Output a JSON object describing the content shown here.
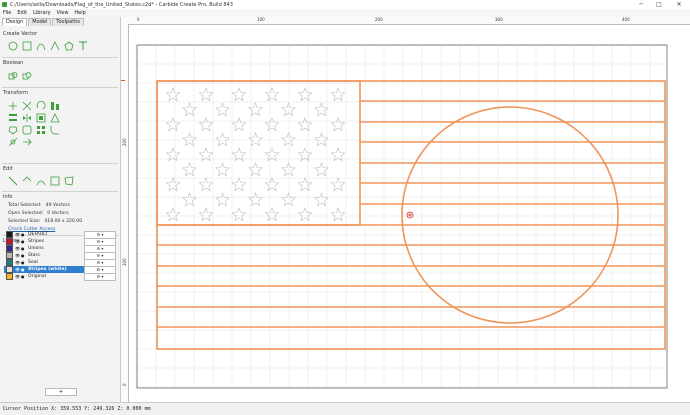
{
  "window": {
    "title": "C:/Users/sella/Downloads/Flag_of_the_United_States.c2d* - Carbide Create Pro, Build 843",
    "minimize": "─",
    "maximize": "□",
    "close": "✕"
  },
  "menu": [
    "File",
    "Edit",
    "Library",
    "View",
    "Help"
  ],
  "tabs": [
    "Design",
    "Model",
    "Toolpaths"
  ],
  "sections": {
    "create_vector": "Create Vector",
    "boolean": "Boolean",
    "transform": "Transform",
    "edit": "Edit",
    "info": "Info",
    "layers": "Layers"
  },
  "info": {
    "total_selected_label": "Total Selected:",
    "total_selected": "49 Vectors",
    "open_selected_label": "Open Selected:",
    "open_selected": "0 Vectors",
    "selected_size_label": "Selected Size:",
    "selected_size": "418.00 x 220.00",
    "check_cutter": "Check Cutter Access"
  },
  "layers": [
    {
      "name": "DEFAULT",
      "color": "#1a1a1a"
    },
    {
      "name": "Stripes",
      "color": "#c8102e"
    },
    {
      "name": "Unions",
      "color": "#2b2b8f"
    },
    {
      "name": "Stars",
      "color": "#b9b9b9"
    },
    {
      "name": "Seal",
      "color": "#1f7a7a"
    },
    {
      "name": "Stripes (white)",
      "color": "#e8e0d0"
    },
    {
      "name": "Original",
      "color": "#f2b81a"
    }
  ],
  "layer_gear": "⚙ ▾",
  "add_layer": "+",
  "ruler": {
    "top": [
      "0",
      "100",
      "200",
      "300",
      "400"
    ],
    "left": [
      "200",
      "100",
      "0"
    ]
  },
  "status": {
    "cursor": "Cursor Position X: 359.553 Y: 249.326 Z: 0.000 mm"
  },
  "colors": {
    "vector_selected": "#f0955a",
    "stars": "#bdbdbd",
    "selection_layer": "#2f7fd1"
  }
}
